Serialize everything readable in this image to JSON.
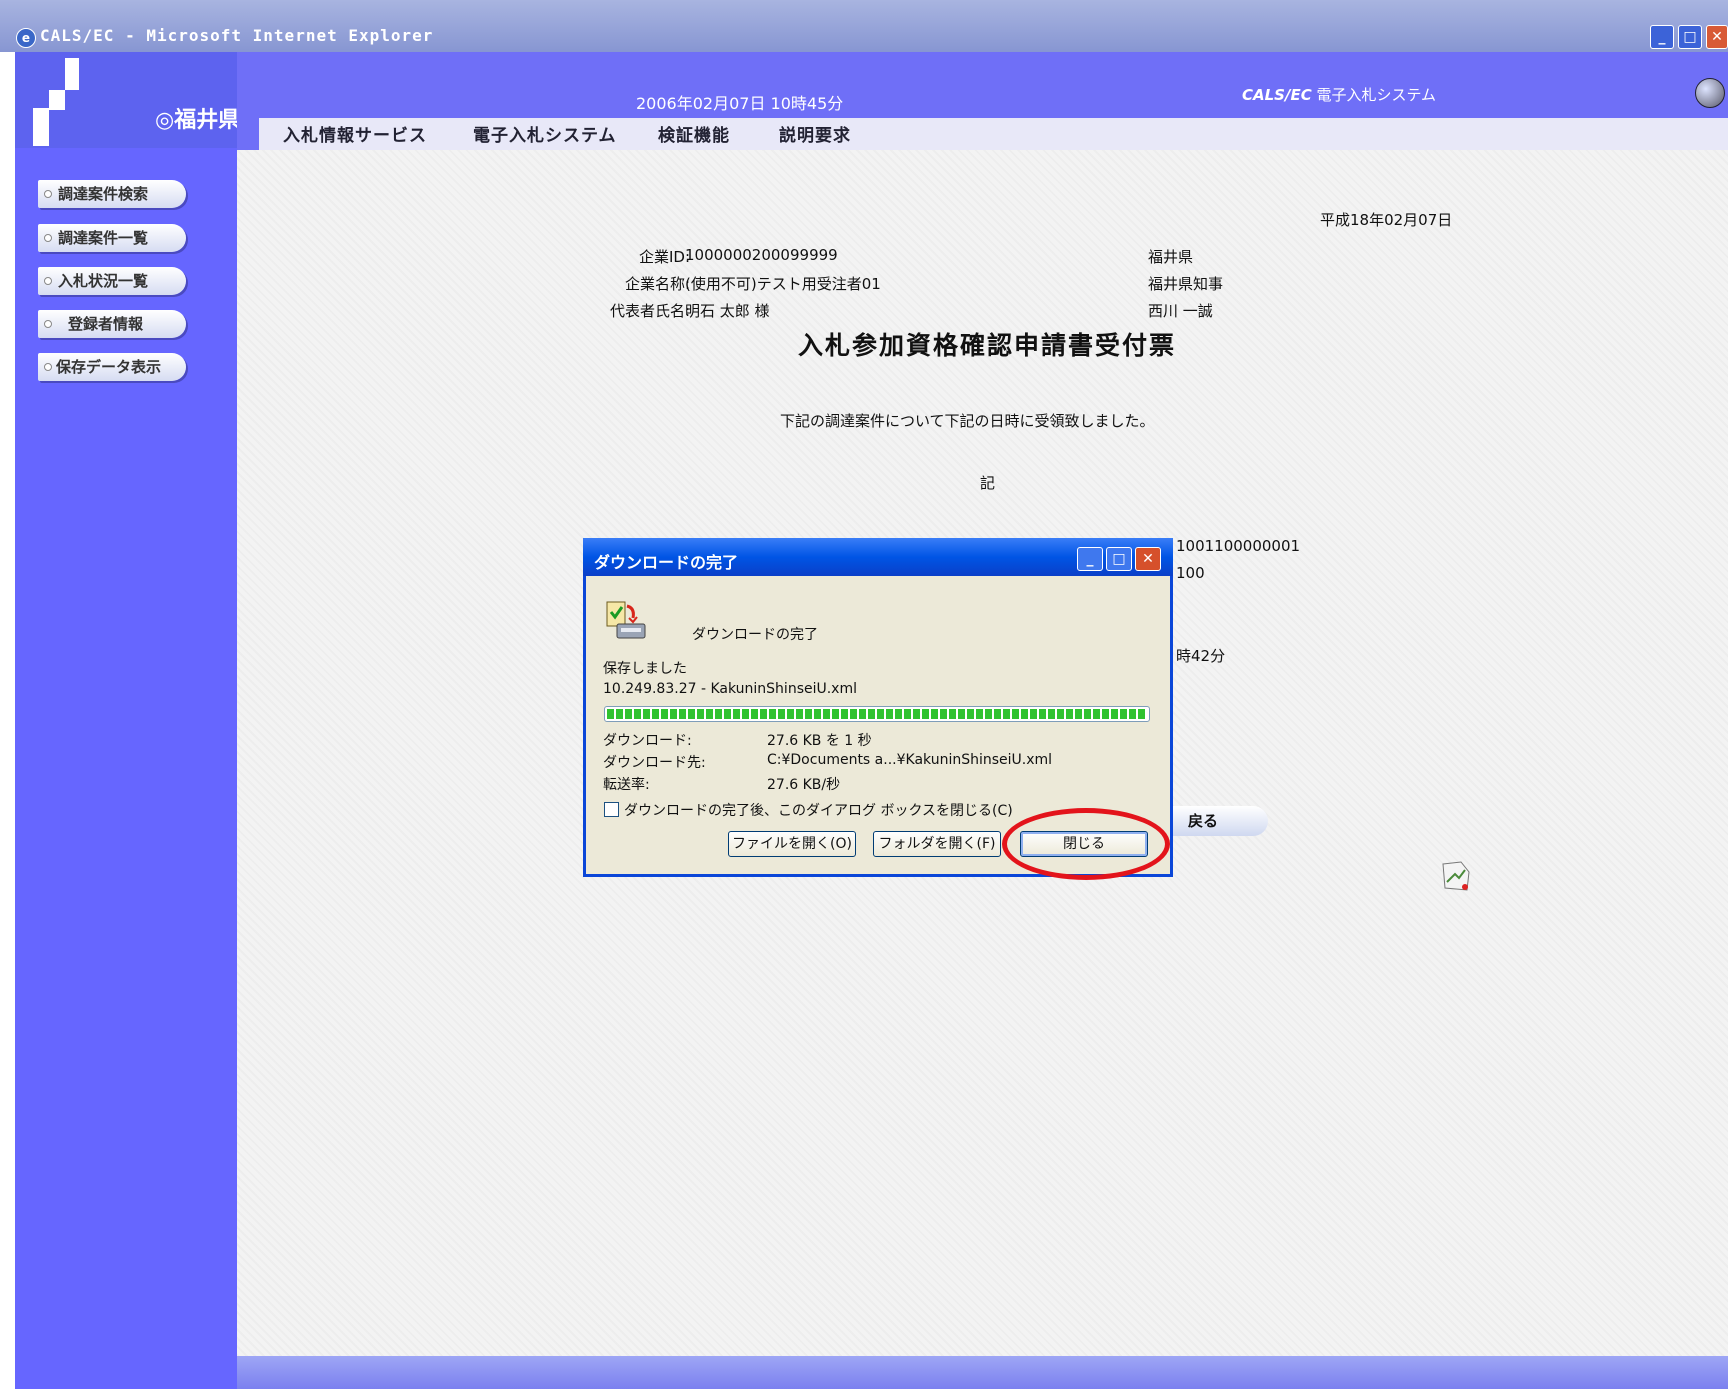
{
  "window": {
    "title": "CALS/EC - Microsoft Internet Explorer",
    "min": "_",
    "max": "□",
    "close": "✕"
  },
  "logo": {
    "text": "福井県"
  },
  "header": {
    "datetime": "2006年02月07日 10時45分",
    "system_brand": "CALS/EC",
    "system_name": "電子入札システム"
  },
  "menu": [
    "入札情報サービス",
    "電子入札システム",
    "検証機能",
    "説明要求"
  ],
  "sidebar": {
    "items": [
      "調達案件検索",
      "調達案件一覧",
      "入札状況一覧",
      "登録者情報",
      "保存データ表示"
    ]
  },
  "document": {
    "date": "平成18年02月07日",
    "company_id_label": "企業ID:",
    "company_id": "1000000200099999",
    "company_name_label": "企業名称:",
    "company_name": "(使用不可)テスト用受注者01",
    "rep_label": "代表者氏名:",
    "rep_name": "明石 太郎 様",
    "issuer_org": "福井県",
    "issuer_title": "福井県知事",
    "issuer_name": "西川 一誠",
    "title": "入札参加資格確認申請書受付票",
    "message": "下記の調達案件について下記の日時に受領致しました。",
    "ki": "記",
    "partial_1": "1001100000001",
    "partial_2": "100",
    "partial_3": "時42分",
    "back_label": "戻る"
  },
  "dialog": {
    "title": "ダウンロードの完了",
    "heading": "ダウンロードの完了",
    "saved": "保存しました",
    "file": "10.249.83.27 - KakuninShinseiU.xml",
    "progress": 1.0,
    "download_label": "ダウンロード:",
    "download_value": "27.6 KB を 1 秒",
    "dest_label": "ダウンロード先:",
    "dest_value": "C:¥Documents a...¥KakuninShinseiU.xml",
    "rate_label": "転送率:",
    "rate_value": "27.6 KB/秒",
    "checkbox_label": "ダウンロードの完了後、このダイアログ ボックスを閉じる(C)",
    "checkbox_checked": false,
    "btn_open_file": "ファイルを開く(O)",
    "btn_open_folder": "フォルダを開く(F)",
    "btn_close": "閉じる"
  },
  "colors": {
    "sidebar": "#6666ff",
    "header": "#6f6ff7",
    "dialog_title": "#0055e5",
    "highlight": "#e3141b"
  }
}
